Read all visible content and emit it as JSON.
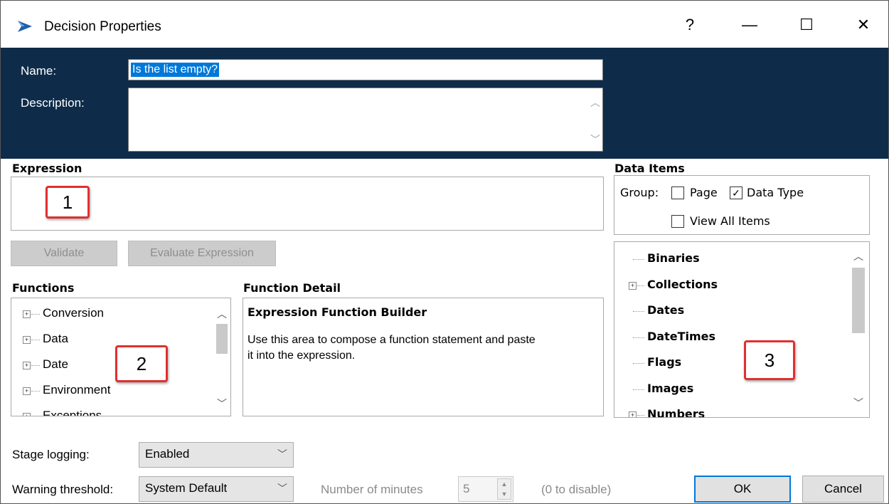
{
  "window": {
    "title": "Decision Properties",
    "controls": {
      "help": "?",
      "minimize": "—",
      "maximize": "☐",
      "close": "✕"
    }
  },
  "header": {
    "name_label": "Name:",
    "name_value": "Is the list empty?",
    "description_label": "Description:",
    "description_value": ""
  },
  "expression": {
    "label": "Expression",
    "callout": "1",
    "validate_label": "Validate",
    "evaluate_label": "Evaluate Expression"
  },
  "functions": {
    "label": "Functions",
    "callout": "2",
    "items": [
      "Conversion",
      "Data",
      "Date",
      "Environment",
      "Exceptions"
    ]
  },
  "function_detail": {
    "label": "Function Detail",
    "heading": "Expression Function Builder",
    "body": "Use this area to compose a function statement and paste it into the expression.",
    "body_line1": "Use this area to compose a function statement and paste",
    "body_line2": "it into the expression."
  },
  "data_items": {
    "label": "Data Items",
    "group_label": "Group:",
    "page_label": "Page",
    "page_checked": false,
    "data_type_label": "Data Type",
    "data_type_checked": true,
    "view_all_label": "View All Items",
    "view_all_checked": false,
    "callout": "3",
    "items": [
      {
        "label": "Binaries",
        "expandable": false
      },
      {
        "label": "Collections",
        "expandable": true
      },
      {
        "label": "Dates",
        "expandable": false
      },
      {
        "label": "DateTimes",
        "expandable": false
      },
      {
        "label": "Flags",
        "expandable": false
      },
      {
        "label": "Images",
        "expandable": false
      },
      {
        "label": "Numbers",
        "expandable": true
      }
    ]
  },
  "footer": {
    "stage_logging_label": "Stage logging:",
    "stage_logging_value": "Enabled",
    "warning_threshold_label": "Warning threshold:",
    "warning_threshold_value": "System Default",
    "minutes_label": "Number of minutes",
    "minutes_value": "5",
    "disable_hint": "(0 to disable)",
    "ok_label": "OK",
    "cancel_label": "Cancel"
  },
  "colors": {
    "header_bg": "#0e2c4a",
    "selection": "#0078d7",
    "callout_border": "#e03030"
  }
}
